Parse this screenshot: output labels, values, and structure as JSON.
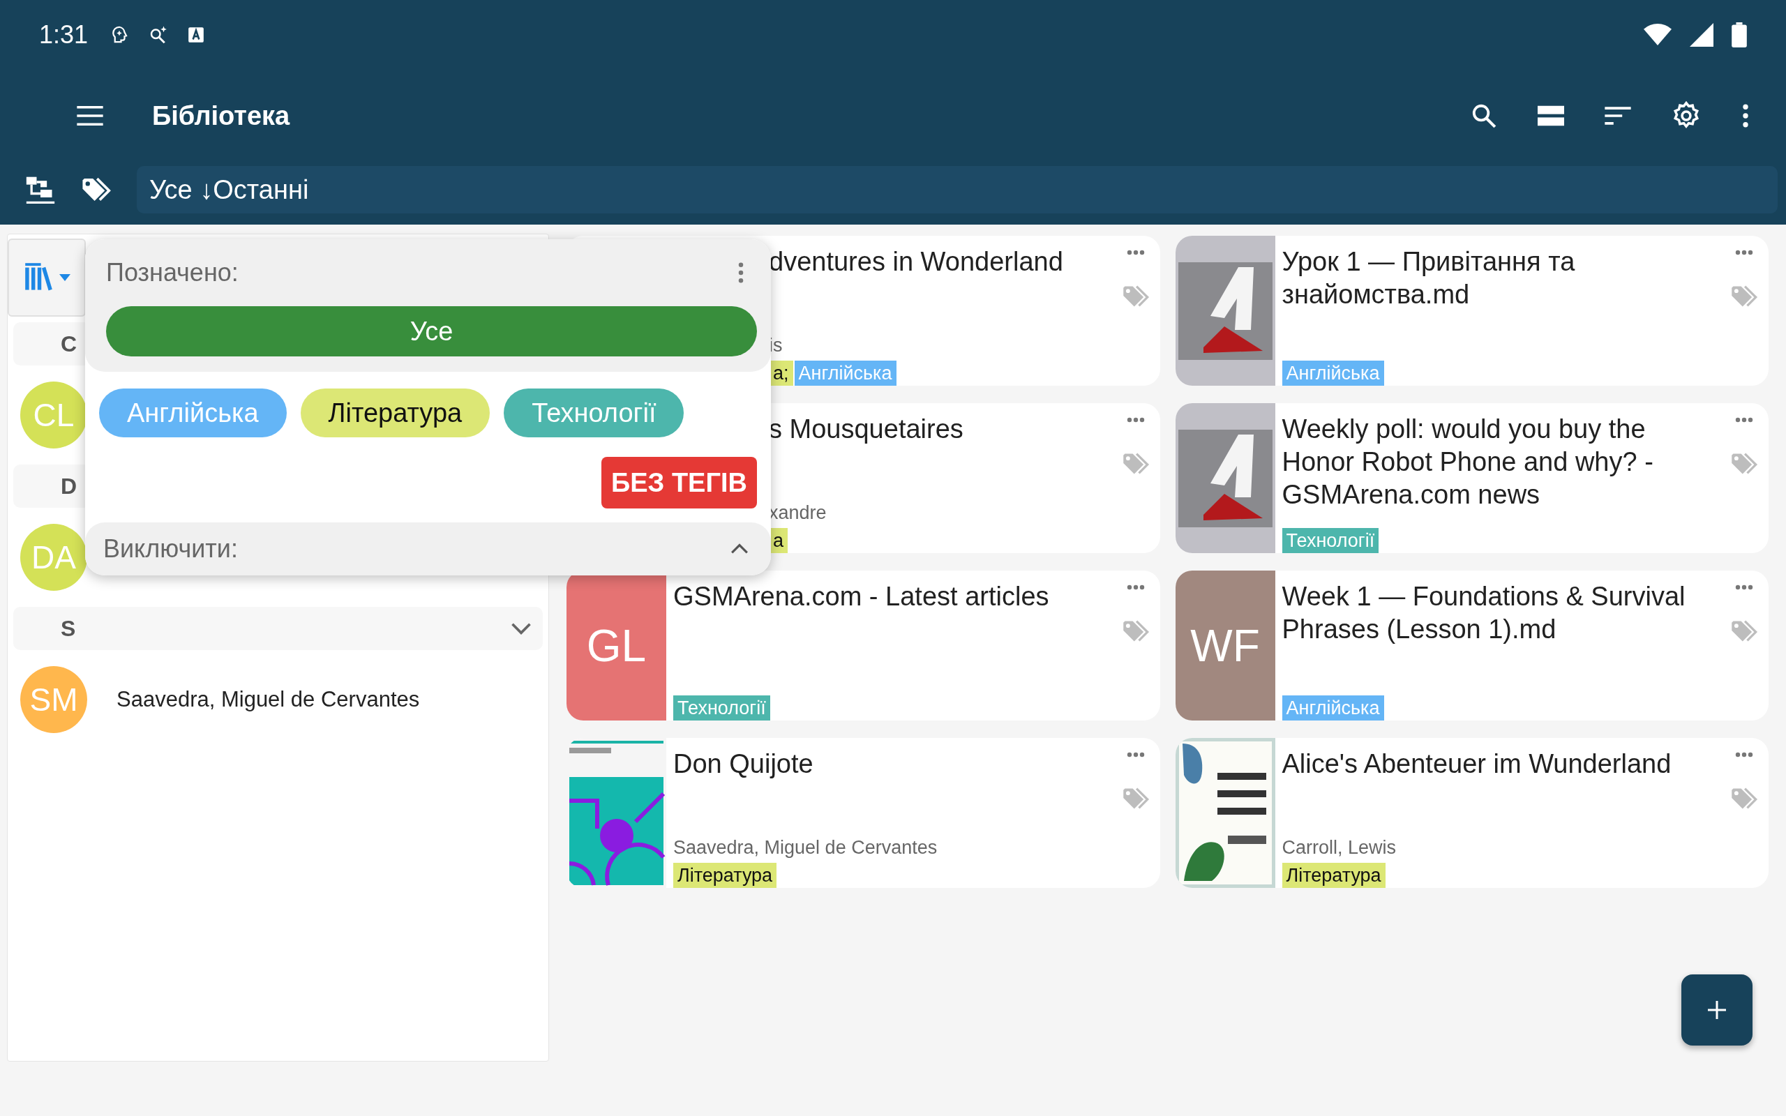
{
  "status_bar": {
    "time": "1:31"
  },
  "toolbar": {
    "title": "Бібліотека"
  },
  "filter_bar": {
    "value": "Усе ↓Останні"
  },
  "sidebar": {
    "sections": [
      {
        "letter": "C",
        "authors": [
          {
            "initials": "CL",
            "color": "#d4e157"
          }
        ]
      },
      {
        "letter": "D",
        "authors": [
          {
            "initials": "DA",
            "color": "#d4e157"
          }
        ]
      },
      {
        "letter": "S",
        "chevron": true,
        "authors": [
          {
            "initials": "SM",
            "name": "Saavedra, Miguel de Cervantes",
            "color": "#ffb74d"
          }
        ]
      }
    ]
  },
  "cards": [
    {
      "partly_hidden": true,
      "title": "dventures in Wonderland",
      "author": "is",
      "tags": [
        {
          "label": "а;",
          "color": "#dce775"
        },
        {
          "label": "Англійська",
          "color": "#64b5f6"
        }
      ]
    },
    {
      "thumb": {
        "kind": "picture"
      },
      "title": "Урок 1 — Привітання та знайомства.md",
      "tags": [
        {
          "label": "Англійська",
          "color": "#64b5f6"
        }
      ]
    },
    {
      "partly_hidden": true,
      "title": "s Mousquetaires",
      "author": "xandre",
      "tags": [
        {
          "label": "а",
          "color": "#dce775"
        }
      ]
    },
    {
      "thumb": {
        "kind": "picture"
      },
      "title": "Weekly poll: would you buy the Honor Robot Phone and why? - GSMArena.com news",
      "tags": [
        {
          "label": "Технології",
          "color": "#4db6ac"
        }
      ]
    },
    {
      "thumb": {
        "kind": "initials",
        "text": "GL",
        "color": "#e57373"
      },
      "title": "GSMArena.com - Latest articles",
      "tags": [
        {
          "label": "Технології",
          "color": "#4db6ac"
        }
      ]
    },
    {
      "thumb": {
        "kind": "initials",
        "text": "WF",
        "color": "#a1887f"
      },
      "title": "Week 1 — Foundations & Survival Phrases (Lesson 1).md",
      "tags": [
        {
          "label": "Англійська",
          "color": "#64b5f6"
        }
      ]
    },
    {
      "thumb": {
        "kind": "cover"
      },
      "title": "Don Quijote",
      "author": "Saavedra, Miguel de Cervantes",
      "tags": [
        {
          "label": "Література",
          "color": "#dce775"
        }
      ]
    },
    {
      "thumb": {
        "kind": "cover2"
      },
      "title": "Alice's Abenteuer im Wunderland",
      "author": "Carroll, Lewis",
      "tags": [
        {
          "label": "Література",
          "color": "#dce775"
        }
      ]
    }
  ],
  "tag_popup": {
    "title": "Позначено:",
    "all_button": "Усе",
    "tags": [
      {
        "label": "Англійська",
        "color": "#64b5f6"
      },
      {
        "label": "Література",
        "color": "#dce775"
      },
      {
        "label": "Технології",
        "color": "#4db6ac"
      }
    ],
    "untagged_button": "БЕЗ ТЕГІВ",
    "exclude_label": "Виключити:"
  }
}
